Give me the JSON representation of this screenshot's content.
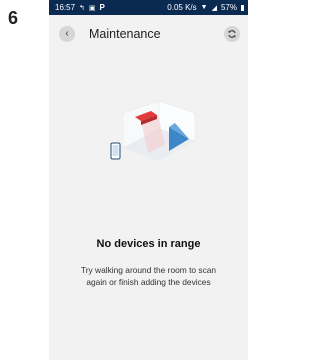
{
  "step": {
    "number": "6"
  },
  "status_bar": {
    "time": "16:57",
    "left_icons": [
      "notification-icon",
      "photo-icon",
      "p-app-icon"
    ],
    "speed": "0.05 K/s",
    "right_icons": [
      "wifi-icon",
      "signal-icon"
    ],
    "battery": "57%",
    "background_color": "#0b2a52"
  },
  "header": {
    "title": "Maintenance",
    "back_icon": "chevron-left-icon",
    "refresh_icon": "refresh-icon"
  },
  "empty_state": {
    "illustration": "device-scan-illustration",
    "title": "No devices in range",
    "description": "Try walking around the room to scan again or finish adding the devices"
  },
  "colors": {
    "accent_blue": "#3d87c9",
    "accent_red": "#e23b3b"
  }
}
